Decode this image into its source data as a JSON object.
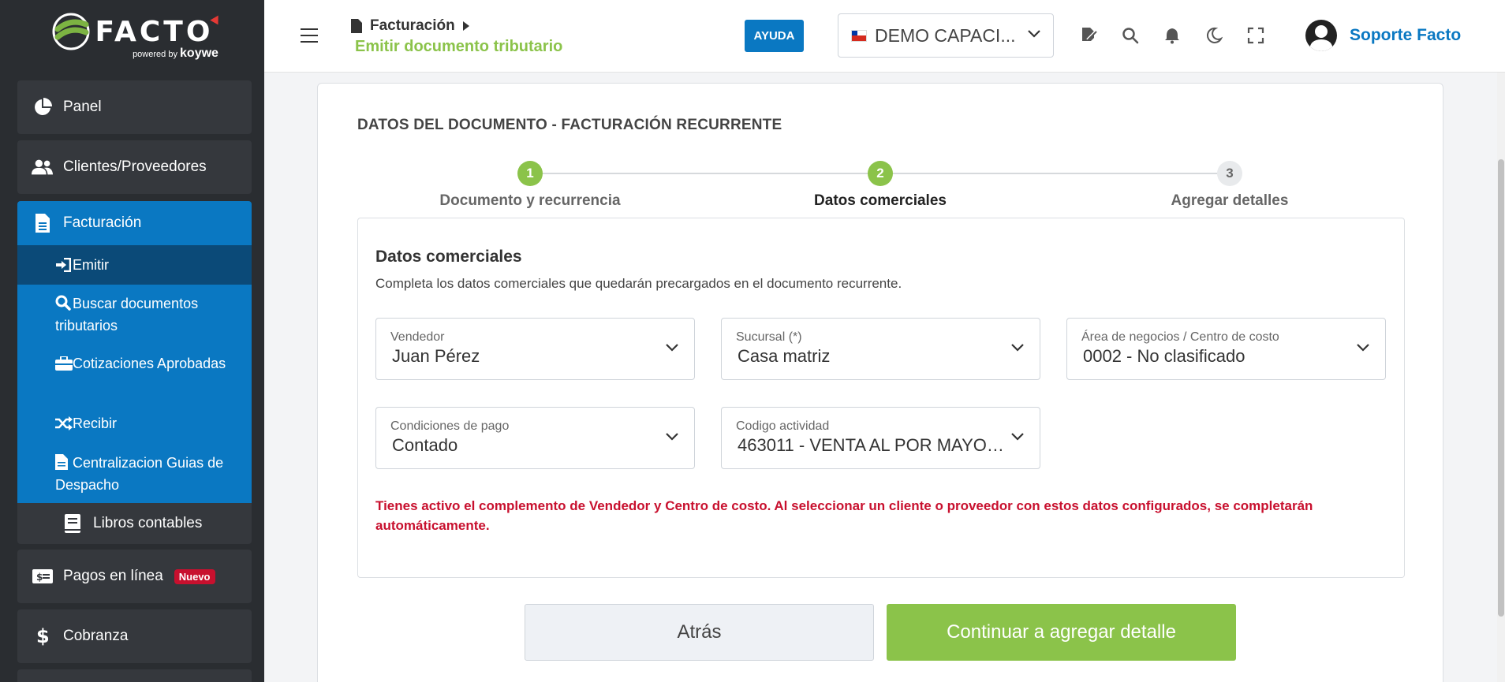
{
  "brand": {
    "name": "FACTO",
    "powered": "powered",
    "by": "by",
    "partner": "koywe"
  },
  "sidebar": {
    "items": [
      {
        "label": "Panel",
        "icon": "pie-chart-icon"
      },
      {
        "label": "Clientes/Proveedores",
        "icon": "users-icon"
      },
      {
        "label": "Facturación",
        "icon": "document-icon"
      },
      {
        "label": "Libros contables",
        "icon": "book-icon"
      },
      {
        "label": "Pagos en línea",
        "icon": "money-bill-icon",
        "badge": "Nuevo"
      },
      {
        "label": "Cobranza",
        "icon": "dollar-icon"
      }
    ],
    "submenu": [
      {
        "label": "Emitir",
        "icon": "sign-in-icon"
      },
      {
        "label": "Buscar documentos tributarios",
        "icon": "search-icon"
      },
      {
        "label": "Cotizaciones Aprobadas",
        "icon": "briefcase-icon"
      },
      {
        "label": "Recibir",
        "icon": "shuffle-icon"
      },
      {
        "label": "Centralizacion Guias de Despacho",
        "icon": "file-icon"
      }
    ]
  },
  "header": {
    "breadcrumb_root": "Facturación",
    "breadcrumb_current": "Emitir documento tributario",
    "help_label": "AYUDA",
    "company": "DEMO CAPACI...",
    "user_name": "Soporte Facto"
  },
  "form": {
    "title": "DATOS DEL DOCUMENTO - FACTURACIÓN RECURRENTE",
    "steps": [
      {
        "number": "1",
        "label": "Documento y recurrencia",
        "status": "done"
      },
      {
        "number": "2",
        "label": "Datos comerciales",
        "status": "current"
      },
      {
        "number": "3",
        "label": "Agregar detalles",
        "status": "pending"
      }
    ],
    "section_title": "Datos comerciales",
    "section_desc": "Completa los datos comerciales que quedarán precargados en el documento recurrente.",
    "fields": [
      {
        "label": "Vendedor",
        "value": "Juan Pérez"
      },
      {
        "label": "Sucursal (*)",
        "value": "Casa matriz"
      },
      {
        "label": "Área de negocios / Centro de costo",
        "value": "0002 - No clasificado"
      },
      {
        "label": "Condiciones de pago",
        "value": "Contado"
      },
      {
        "label": "Codigo actividad",
        "value": "463011 - VENTA AL POR MAYOR..."
      }
    ],
    "warning": "Tienes activo el complemento de Vendedor y Centro de costo. Al seleccionar un cliente o proveedor con estos datos configurados, se completarán automáticamente.",
    "back_label": "Atrás",
    "next_label": "Continuar a agregar detalle"
  },
  "colors": {
    "primary": "#0a78c2",
    "success": "#8bc34a",
    "danger": "#c8102e",
    "sidebar": "#2a2d31"
  }
}
